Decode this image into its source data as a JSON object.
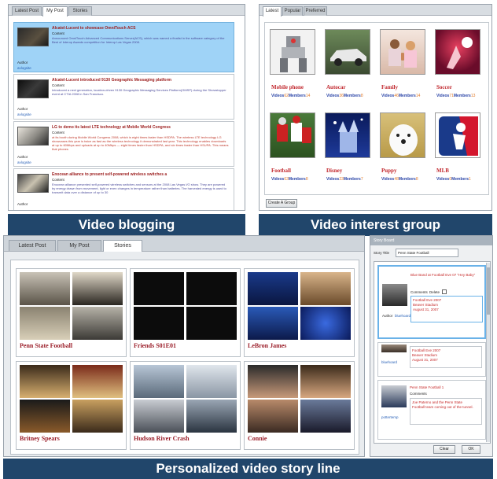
{
  "blog": {
    "tabs": [
      "Latest Post",
      "My Post",
      "Stories"
    ],
    "active_tab": 1,
    "posts": [
      {
        "title": "Alcatel-Lucent to showcase OmniTouch ACS",
        "label": "Content",
        "text": "Announced OmniTouch Advanced Communications Server(ACS), which was named a finalist in the software category of the Best of Interop Awards competition for Interop Las Vegas 2008.",
        "author_label": "Author",
        "author": "avlogsite"
      },
      {
        "title": "Alcatel-Lucent introduced 9130 Geographic Messaging platform",
        "label": "Content",
        "text": "Introduced a next generation, location-driven 9130 Geographic Messaging Services Platform(GMSP) during the Showstopper event at CTIA 2008 in San Francisco.",
        "author_label": "Author",
        "author": "avlogsite"
      },
      {
        "title": "LG to demo its latest LTE technology at Mobile World Congress",
        "label": "Content",
        "text": "at its booth during Mobile World Congress 2008, which is eight times faster than HSDPA. The wireless LTE technology LG showcases this year is twice as fast as the wireless technology it demonstrated last year. This technology enables downloads at up to 60Mbps and uploads at up to 40Mbps — eight times faster than HSDPA, and six times faster than HSUPA. This means that phones",
        "author_label": "Author",
        "author": "avlogsite"
      },
      {
        "title": "Enocean alliance to present self-powered wireless switches a",
        "label": "Content",
        "text": "Enocean alliance presented self-powered wireless switches and sensors at the 2008 Las Vegas I/O show. They are powered by energy drawn from movement, light or even changes in temperature rather than batteries. The harvested energy is used to transmit data over a distance of up to 30",
        "author_label": "Author",
        "author": ""
      }
    ],
    "caption": "Video blogging"
  },
  "interest": {
    "tabs": [
      "Latest",
      "Popular",
      "Preferred"
    ],
    "active_tab": 0,
    "groups": [
      {
        "name": "Mobile phone",
        "videos": "62",
        "members": "14",
        "picture": "robot"
      },
      {
        "name": "Autocar",
        "videos": "36",
        "members": "8",
        "picture": "car"
      },
      {
        "name": "Family",
        "videos": "46",
        "members": "14",
        "picture": "family"
      },
      {
        "name": "Soccer",
        "videos": "71",
        "members": "13",
        "picture": "soccer"
      },
      {
        "name": "Football",
        "videos": "63",
        "members": "8",
        "picture": "football"
      },
      {
        "name": "Disney",
        "videos": "23",
        "members": "7",
        "picture": "castle"
      },
      {
        "name": "Puppy",
        "videos": "48",
        "members": "8",
        "picture": "puppy"
      },
      {
        "name": "MLB",
        "videos": "0",
        "members": "1",
        "picture": "mlb"
      }
    ],
    "videos_label": "Videos",
    "members_label": "Members",
    "create_button": "Create A Group",
    "caption": "Video interest group"
  },
  "story": {
    "tabs": [
      "Latest Post",
      "My Post",
      "Stories"
    ],
    "active_tab": 2,
    "stories": [
      {
        "title": "Penn State Football",
        "theme": "stadium"
      },
      {
        "title": "Friends S01E01",
        "theme": "credits"
      },
      {
        "title": "LeBron James",
        "theme": "tv"
      },
      {
        "title": "Britney Spears",
        "theme": "music"
      },
      {
        "title": "Hudson River Crash",
        "theme": "plane"
      },
      {
        "title": "Connie",
        "theme": "talent"
      }
    ],
    "caption": "Personalized video story line"
  },
  "board": {
    "header": "Story Board",
    "story_title_label": "Story Title",
    "story_title_value": "Penn State Football",
    "entries": [
      {
        "heading": "Blue Band at Football Eve 07 \"Hey Baby\"",
        "comments_label": "Comments",
        "delete_label": "Delete",
        "comment_lines": [
          "Football Eve 2007",
          "Beaver Stadium",
          "August 31, 2007"
        ],
        "author_label": "Author",
        "author": "bluehoard"
      },
      {
        "heading": "",
        "comment_lines": [
          "Football Eve 2007",
          "Beaver Stadium",
          "August 31, 2007"
        ],
        "author": "bluehoard"
      },
      {
        "heading": "Penn State Football 1",
        "comments_label": "Comments",
        "comment_lines": [
          "Joe Paterno and the Penn State",
          "Football team coming out of the tunnel."
        ],
        "author": "pottertemp"
      }
    ],
    "clear_button": "Clear",
    "ok_button": "OK"
  }
}
